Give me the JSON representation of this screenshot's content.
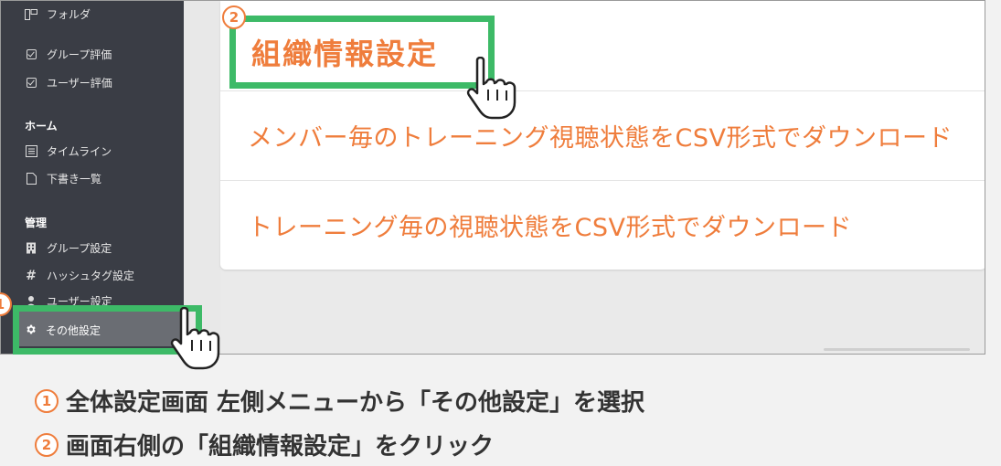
{
  "sidebar": {
    "items_top": [
      {
        "label": "フォルダ",
        "icon": "folder-icon"
      },
      {
        "label": "グループ評価",
        "icon": "checkbox-icon"
      },
      {
        "label": "ユーザー評価",
        "icon": "checkbox-icon"
      }
    ],
    "home_heading": "ホーム",
    "home_items": [
      {
        "label": "タイムライン",
        "icon": "timeline-icon"
      },
      {
        "label": "下書き一覧",
        "icon": "document-icon"
      }
    ],
    "admin_heading": "管理",
    "admin_items": [
      {
        "label": "グループ設定",
        "icon": "building-icon"
      },
      {
        "label": "ハッシュタグ設定",
        "icon": "hash-icon"
      },
      {
        "label": "ユーザー設定",
        "icon": "user-icon"
      }
    ],
    "active_item": {
      "label": "その他設定",
      "icon": "gear-icon"
    }
  },
  "main": {
    "title": "組織情報設定",
    "links": [
      "メンバー毎のトレーニング視聴状態をCSV形式でダウンロード",
      "トレーニング毎の視聴状態をCSV形式でダウンロード"
    ]
  },
  "badges": {
    "one": "1",
    "two": "2"
  },
  "captions": [
    {
      "num": "1",
      "text": "全体設定画面 左側メニューから「その他設定」を選択"
    },
    {
      "num": "2",
      "text": "画面右側の「組織情報設定」をクリック"
    }
  ],
  "colors": {
    "accent": "#ef7d3c",
    "highlight": "#3dba67",
    "sidebar": "#3a3d45"
  }
}
